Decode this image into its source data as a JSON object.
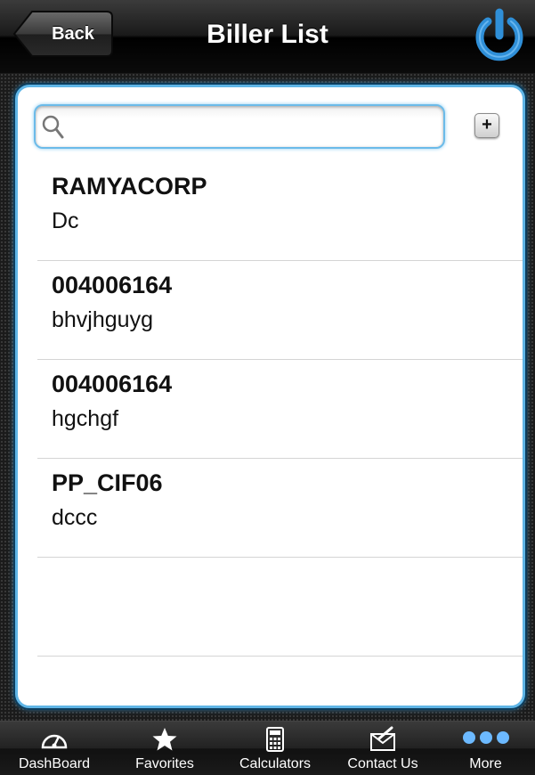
{
  "header": {
    "back_label": "Back",
    "title": "Biller List",
    "power_icon": "power-icon"
  },
  "search": {
    "value": "",
    "placeholder": "",
    "icon": "search-icon",
    "add_label": "+"
  },
  "billers": [
    {
      "name": "RAMYACORP",
      "description": "Dc"
    },
    {
      "name": "004006164",
      "description": "bhvjhguyg"
    },
    {
      "name": "004006164",
      "description": "hgchgf"
    },
    {
      "name": "PP_CIF06",
      "description": "dccc"
    }
  ],
  "tabbar": {
    "tabs": [
      {
        "label": "DashBoard",
        "icon": "dashboard-gauge-icon"
      },
      {
        "label": "Favorites",
        "icon": "star-icon"
      },
      {
        "label": "Calculators",
        "icon": "calculator-icon"
      },
      {
        "label": "Contact Us",
        "icon": "mail-icon"
      },
      {
        "label": "More",
        "icon": "more-dots-icon"
      }
    ]
  },
  "colors": {
    "accent": "#5fb5e6",
    "header_bg": "#000000",
    "power_icon": "#2f8fd8"
  }
}
